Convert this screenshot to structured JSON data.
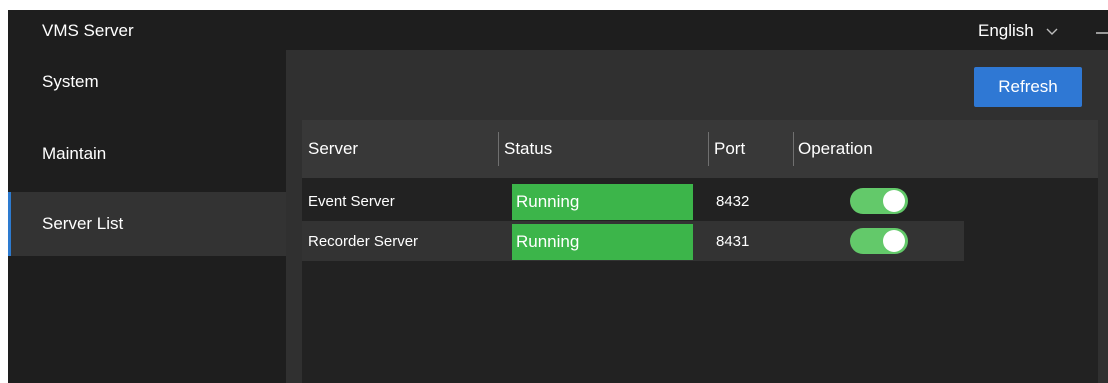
{
  "app": {
    "title": "VMS Server",
    "language": "English"
  },
  "sidebar": {
    "items": [
      {
        "label": "System"
      },
      {
        "label": "Maintain"
      },
      {
        "label": "Server List"
      }
    ],
    "active": "Server List"
  },
  "toolbar": {
    "refresh_label": "Refresh"
  },
  "table": {
    "columns": [
      "Server",
      "Status",
      "Port",
      "Operation"
    ],
    "rows": [
      {
        "server": "Event Server",
        "status": "Running",
        "port": "8432",
        "enabled": true
      },
      {
        "server": "Recorder Server",
        "status": "Running",
        "port": "8431",
        "enabled": true
      }
    ]
  },
  "colors": {
    "accent": "#2f78d4",
    "running": "#3cb54a",
    "toggle_on": "#63c96a"
  }
}
